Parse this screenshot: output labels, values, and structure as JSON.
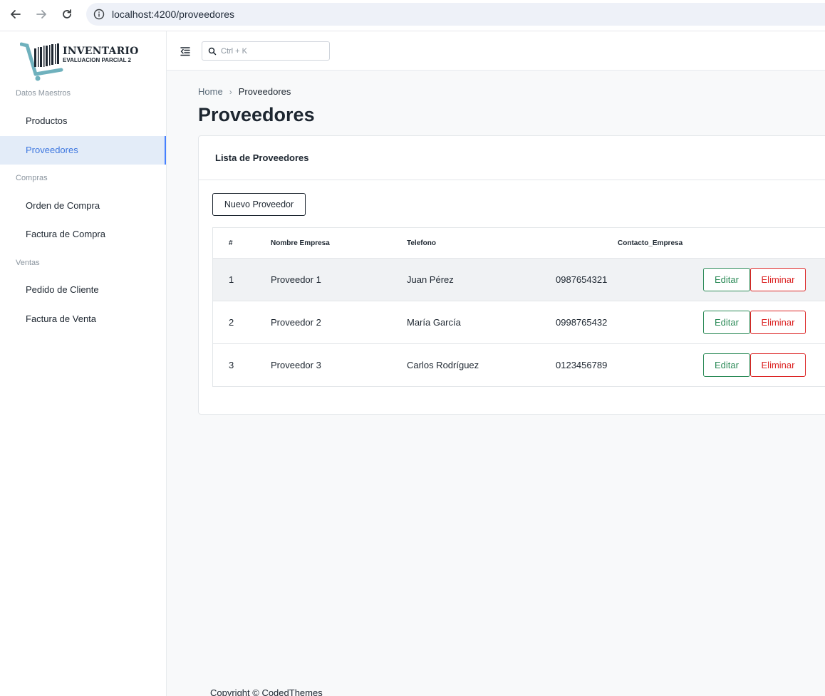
{
  "browser": {
    "url": "localhost:4200/proveedores"
  },
  "brand": {
    "title": "INVENTARIO",
    "subtitle": "EVALUACION PARCIAL 2"
  },
  "sidebar": {
    "sections": [
      {
        "label": "Datos Maestros",
        "items": [
          "Productos",
          "Proveedores"
        ]
      },
      {
        "label": "Compras",
        "items": [
          "Orden de Compra",
          "Factura de Compra"
        ]
      },
      {
        "label": "Ventas",
        "items": [
          "Pedido de Cliente",
          "Factura de Venta"
        ]
      }
    ],
    "active_item": "Proveedores"
  },
  "header": {
    "search_placeholder": "Ctrl + K"
  },
  "breadcrumb": {
    "home": "Home",
    "separator": "›",
    "current": "Proveedores"
  },
  "page": {
    "title": "Proveedores"
  },
  "card": {
    "title": "Lista de Proveedores",
    "new_button": "Nuevo Proveedor"
  },
  "table": {
    "columns": [
      "#",
      "Nombre Empresa",
      "Telefono",
      "Contacto_Empresa"
    ],
    "rows": [
      [
        "1",
        "Proveedor 1",
        "Juan Pérez",
        "0987654321"
      ],
      [
        "2",
        "Proveedor 2",
        "María García",
        "0998765432"
      ],
      [
        "3",
        "Proveedor 3",
        "Carlos Rodríguez",
        "0123456789"
      ]
    ],
    "edit_label": "Editar",
    "delete_label": "Eliminar"
  },
  "footer": {
    "text": "Copyright © CodedThemes"
  },
  "colors": {
    "accent": "#4680ff",
    "active_bg": "#e3ecf8",
    "edit": "#2b8a57",
    "delete": "#dc2626"
  }
}
